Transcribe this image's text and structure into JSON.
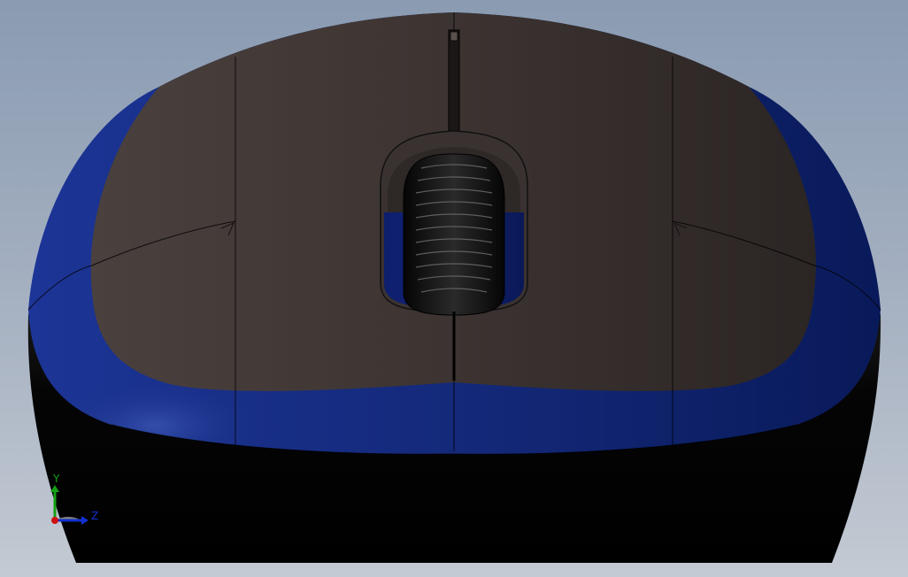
{
  "viewport": {
    "model": "mouse-top-view"
  },
  "triad": {
    "y_label": "Y",
    "z_label": "Z",
    "y_color": "#14a014",
    "z_color": "#1030d0",
    "origin_color": "#d01010"
  },
  "colors": {
    "background_top": "#8a9bb2",
    "background_bottom": "#c3cad3",
    "shell": "#3d3534",
    "shell_shade": "#2a2524",
    "trim": "#182f86",
    "trim_dark": "#081446",
    "base": "#050505",
    "wheel": "#111111"
  }
}
